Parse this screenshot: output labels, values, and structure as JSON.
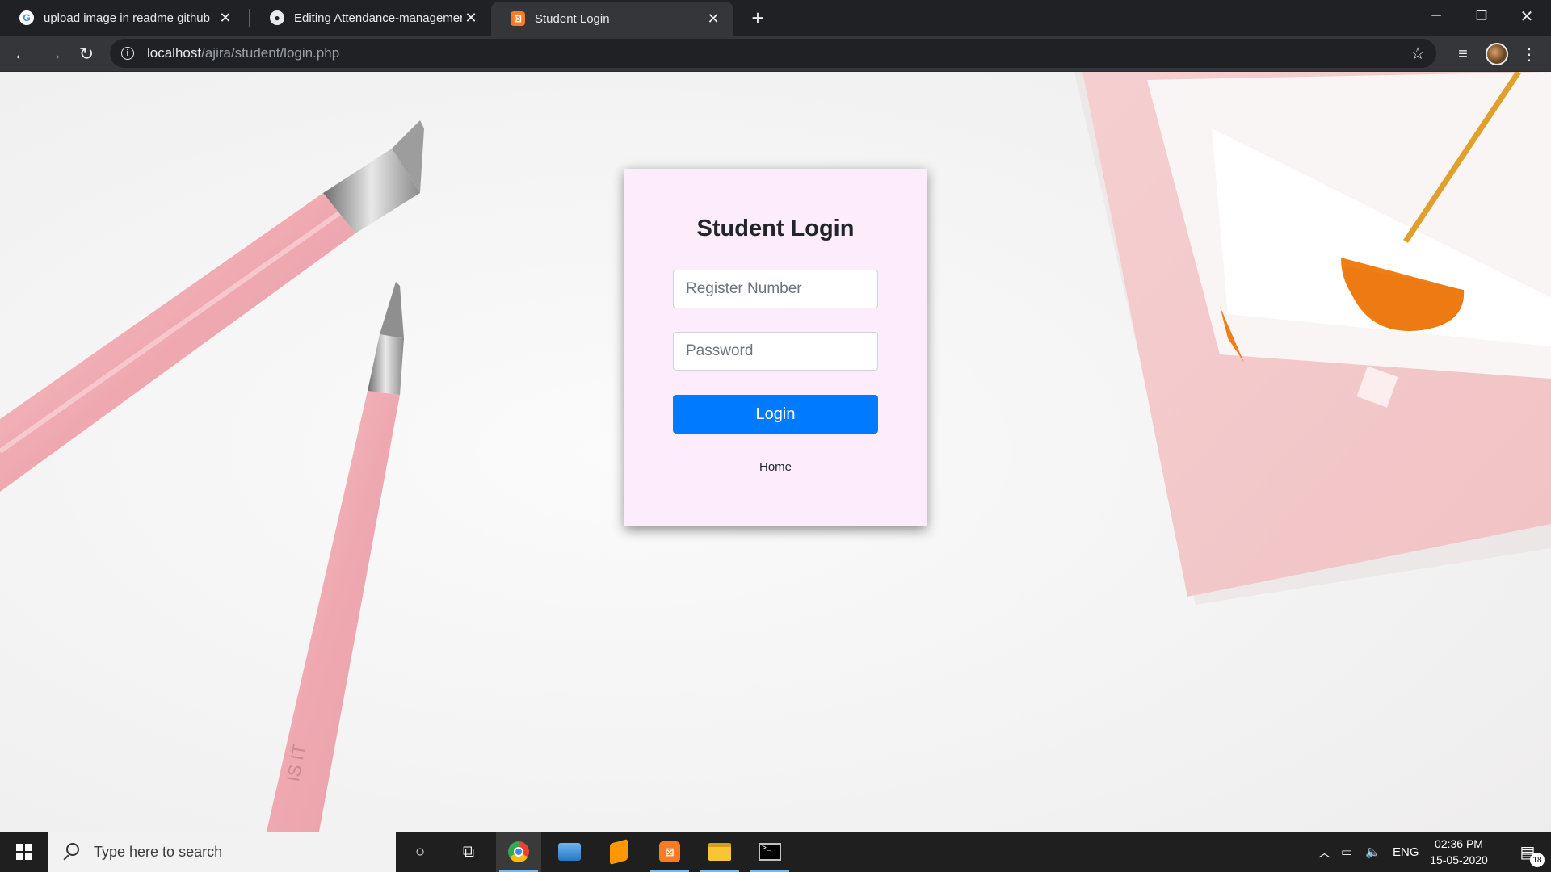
{
  "browser": {
    "tabs": [
      {
        "title": "upload image in readme github",
        "favicon": "google-icon",
        "active": false
      },
      {
        "title": "Editing Attendance-management",
        "favicon": "github-icon",
        "active": false
      },
      {
        "title": "Student Login",
        "favicon": "xampp-icon",
        "active": true
      }
    ],
    "new_tab_label": "+",
    "url_host": "localhost",
    "url_path": "/ajira/student/login.php"
  },
  "page": {
    "title": "Student Login",
    "register_placeholder": "Register Number",
    "password_placeholder": "Password",
    "login_label": "Login",
    "home_link": "Home",
    "card_color": "#fcecfc",
    "button_color": "#007bff"
  },
  "taskbar": {
    "search_placeholder": "Type here to search",
    "language": "ENG",
    "time": "02:36 PM",
    "date": "15-05-2020",
    "notification_count": "18"
  }
}
